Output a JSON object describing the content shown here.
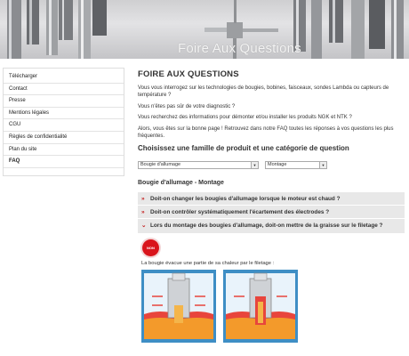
{
  "banner": {
    "title": "Foire Aux Questions"
  },
  "sidebar": {
    "items": [
      {
        "label": "Télécharger"
      },
      {
        "label": "Contact"
      },
      {
        "label": "Presse"
      },
      {
        "label": "Mentions légales"
      },
      {
        "label": "CGU"
      },
      {
        "label": "Règles de confidentialité"
      },
      {
        "label": "Plan du site"
      },
      {
        "label": "FAQ"
      }
    ]
  },
  "main": {
    "title": "FOIRE AUX QUESTIONS",
    "intro": [
      "Vous vous interrogez sur les technologies de bougies, bobines, faisceaux, sondes Lambda ou capteurs de température ?",
      "Vous n'êtes pas sûr de votre diagnostic ?",
      "Vous recherchez des informations pour démonter et/ou installer les produits NGK et NTK ?",
      "Alors, vous êtes sur la bonne page ! Retrouvez dans notre FAQ toutes les réponses à vos questions les plus fréquentes."
    ],
    "choose_title": "Choisissez une famille de produit et une catégorie de question",
    "family_select": "Bougie d'allumage",
    "category_select": "Montage",
    "section_title": "Bougie d'allumage - Montage",
    "questions": [
      {
        "mark": "»",
        "text": "Doit-on changer les bougies d'allumage lorsque le moteur est chaud ?"
      },
      {
        "mark": "»",
        "text": "Doit-on contrôler systématiquement l'écartement des électrodes ?"
      },
      {
        "mark": "»",
        "text": "Lors du montage des bougies d'allumage, doit-on mettre de la graisse sur le filetage ?"
      }
    ],
    "answer": {
      "badge": "NON",
      "text": "La bougie évacue une partie de sa chaleur par le filetage :"
    }
  },
  "colors": {
    "accent": "#c41b1b",
    "badge": "#d9141b",
    "question_bg": "#e8e8e8"
  }
}
